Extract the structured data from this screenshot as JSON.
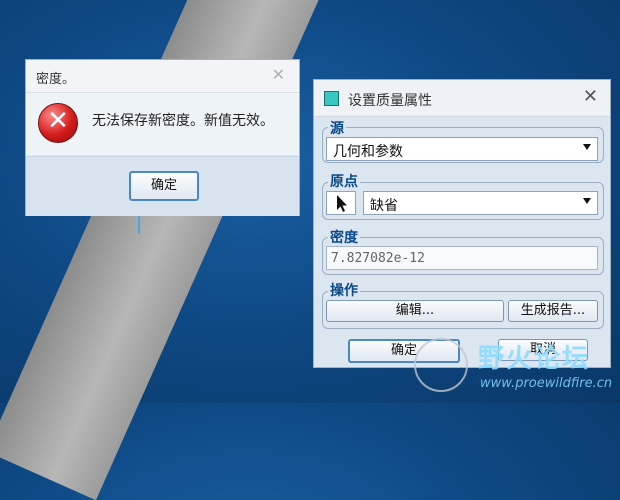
{
  "error_dialog": {
    "title": "密度。",
    "close": "✕",
    "icon_glyph": "✕",
    "message": "无法保存新密度。新值无效。",
    "ok_label": "确定"
  },
  "properties_dialog": {
    "title": "设置质量属性",
    "close": "✕",
    "source": {
      "label": "源",
      "selected": "几何和参数"
    },
    "origin": {
      "label": "原点",
      "selected": "缺省"
    },
    "density": {
      "label": "密度",
      "value": "7.827082e-12"
    },
    "actions": {
      "label": "操作",
      "edit_label": "编辑...",
      "report_label": "生成报告..."
    },
    "ok_label": "确定",
    "cancel_label": "取消"
  },
  "watermark": {
    "name": "野火论坛",
    "url": "www.proewildfire.cn"
  },
  "colors": {
    "background": "#0f4a86",
    "group_label": "#0b4a8a",
    "error_icon": "#d41b1b",
    "teal_icon": "#37c6c2"
  }
}
